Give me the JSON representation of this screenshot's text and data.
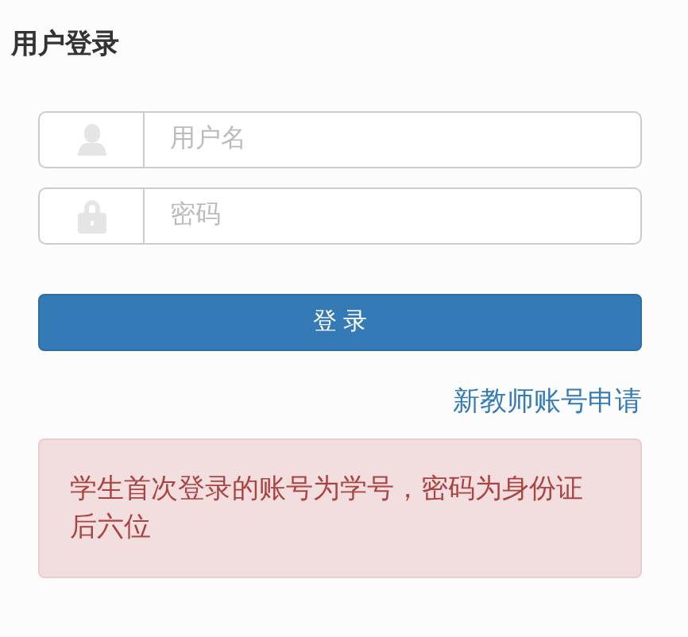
{
  "title": "用户登录",
  "fields": [
    {
      "kind": "user",
      "placeholder": "用户名"
    },
    {
      "kind": "lock",
      "placeholder": "密码"
    }
  ],
  "login_button": "登 录",
  "link": "新教师账号申请",
  "alert": "学生首次登录的账号为学号，密码为身份证后六位"
}
